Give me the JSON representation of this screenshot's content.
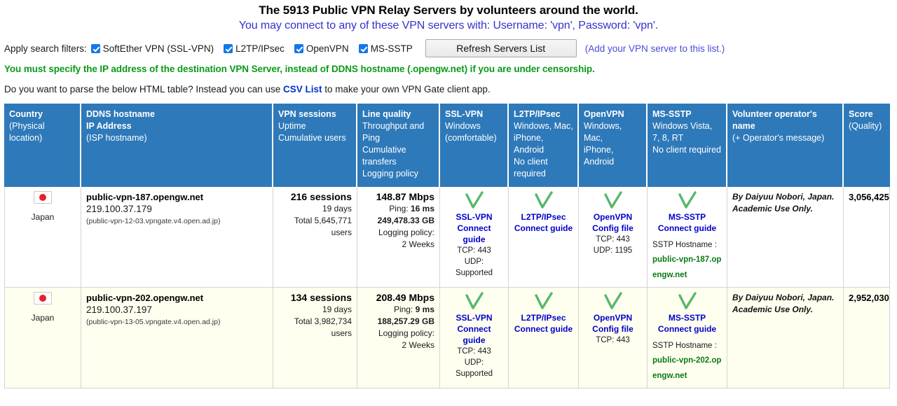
{
  "header": {
    "title": "The 5913 Public VPN Relay Servers by volunteers around the world.",
    "subtitle": "You may connect to any of these VPN servers with: Username: 'vpn', Password: 'vpn'."
  },
  "filters": {
    "label": "Apply search filters:",
    "items": [
      {
        "label": "SoftEther VPN (SSL-VPN)",
        "checked": true
      },
      {
        "label": "L2TP/IPsec",
        "checked": true
      },
      {
        "label": "OpenVPN",
        "checked": true
      },
      {
        "label": "MS-SSTP",
        "checked": true
      }
    ],
    "refresh_label": "Refresh Servers List",
    "add_link": "(Add your VPN server to this list.)"
  },
  "notices": {
    "censorship_warning": "You must specify the IP address of the destination VPN Server, instead of DDNS hostname (.opengw.net) if you are under censorship.",
    "parse_prefix": "Do you want to parse the below HTML table? Instead you can use ",
    "parse_link": "CSV List",
    "parse_suffix": " to make your own VPN Gate client app."
  },
  "colors": {
    "header_blue": "#2e79b9",
    "link_blue": "#0000cc",
    "warning_green": "#0a9a18",
    "row_alt": "#fffff0",
    "check_green": "#57b86a"
  },
  "table": {
    "columns": [
      {
        "key": "country",
        "line1": "Country",
        "line2": "(Physical location)"
      },
      {
        "key": "ddns",
        "line1": "DDNS hostname",
        "line2": "IP Address",
        "line2_bold": true,
        "line3": "(ISP hostname)"
      },
      {
        "key": "sessions",
        "line1": "VPN sessions",
        "line2": "Uptime",
        "line3": "Cumulative users"
      },
      {
        "key": "quality",
        "line1": "Line quality",
        "line2": "Throughput and Ping",
        "line3": "Cumulative transfers",
        "line4": "Logging policy"
      },
      {
        "key": "sslvpn",
        "line1": "SSL-VPN",
        "line2": "Windows",
        "line3": "(comfortable)"
      },
      {
        "key": "l2tp",
        "line1": "L2TP/IPsec",
        "line2": "Windows, Mac,",
        "line3": "iPhone, Android",
        "line4": "No client required"
      },
      {
        "key": "openvpn",
        "line1": "OpenVPN",
        "line2": "Windows, Mac,",
        "line3": "iPhone, Android"
      },
      {
        "key": "mssstp",
        "line1": "MS-SSTP",
        "line2": "Windows Vista,",
        "line3": "7, 8, RT",
        "line4": "No client required"
      },
      {
        "key": "operator",
        "line1": "Volunteer operator's name",
        "line2": "(+ Operator's message)"
      },
      {
        "key": "score",
        "line1": "Score",
        "line2": "(Quality)"
      }
    ],
    "rows": [
      {
        "country": "Japan",
        "flag": "japan-flag-icon",
        "ddns_host": "public-vpn-187.opengw.net",
        "ip": "219.100.37.179",
        "isp": "(public-vpn-12-03.vpngate.v4.open.ad.jp)",
        "sessions": "216 sessions",
        "uptime": "19 days",
        "cumulative_users": "Total 5,645,771 users",
        "throughput": "148.87 Mbps",
        "ping_label": "Ping: ",
        "ping": "16 ms",
        "transfers": "249,478.33 GB",
        "logging_label": "Logging policy:",
        "logging": "2 Weeks",
        "ssl": {
          "available": true,
          "name": "SSL-VPN",
          "action": "Connect guide",
          "tcp": "TCP: 443",
          "udp": "UDP: Supported"
        },
        "l2tp": {
          "available": true,
          "name": "L2TP/IPsec",
          "action": "Connect guide",
          "tcp": "",
          "udp": ""
        },
        "openvpn": {
          "available": true,
          "name": "OpenVPN",
          "action": "Config file",
          "tcp": "TCP: 443",
          "udp": "UDP: 1195"
        },
        "sstp": {
          "available": true,
          "name": "MS-SSTP",
          "action": "Connect guide",
          "host_label": "SSTP Hostname :",
          "host": "public-vpn-187.opengw.net"
        },
        "operator": "By Daiyuu Nobori, Japan. Academic Use Only.",
        "score": "3,056,425"
      },
      {
        "country": "Japan",
        "flag": "japan-flag-icon",
        "ddns_host": "public-vpn-202.opengw.net",
        "ip": "219.100.37.197",
        "isp": "(public-vpn-13-05.vpngate.v4.open.ad.jp)",
        "sessions": "134 sessions",
        "uptime": "19 days",
        "cumulative_users": "Total 3,982,734 users",
        "throughput": "208.49 Mbps",
        "ping_label": "Ping: ",
        "ping": "9 ms",
        "transfers": "188,257.29 GB",
        "logging_label": "Logging policy:",
        "logging": "2 Weeks",
        "ssl": {
          "available": true,
          "name": "SSL-VPN",
          "action": "Connect guide",
          "tcp": "TCP: 443",
          "udp": "UDP: Supported"
        },
        "l2tp": {
          "available": true,
          "name": "L2TP/IPsec",
          "action": "Connect guide",
          "tcp": "",
          "udp": ""
        },
        "openvpn": {
          "available": true,
          "name": "OpenVPN",
          "action": "Config file",
          "tcp": "TCP: 443",
          "udp": ""
        },
        "sstp": {
          "available": true,
          "name": "MS-SSTP",
          "action": "Connect guide",
          "host_label": "SSTP Hostname :",
          "host": "public-vpn-202.opengw.net"
        },
        "operator": "By Daiyuu Nobori, Japan. Academic Use Only.",
        "score": "2,952,030"
      }
    ]
  }
}
